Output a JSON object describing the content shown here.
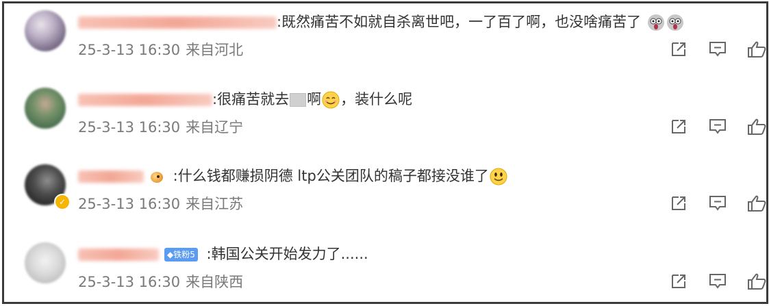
{
  "comments": [
    {
      "text": ":既然痛苦不如就自杀离世吧，一了百了啊，也没啥痛苦了",
      "date": "25-3-13 16:30",
      "location": "来自河北"
    },
    {
      "text_a": ":很痛苦就去",
      "text_b": "啊",
      "text_c": "，装什么呢",
      "date": "25-3-13 16:30",
      "location": "来自辽宁"
    },
    {
      "text": " :什么钱都赚损阴德 ltp公关团队的稿子都接没谁了",
      "date": "25-3-13 16:30",
      "location": "来自江苏"
    },
    {
      "fan_badge": "◆铁粉5",
      "text": " :韩国公关开始发力了......",
      "date": "25-3-13 16:30",
      "location": "来自陕西"
    }
  ],
  "icons": {
    "share": "share-icon",
    "reply": "comment-icon",
    "like": "thumbs-up-icon",
    "verified": "verified-badge-icon"
  },
  "colors": {
    "text": "#333333",
    "meta": "#7a7a7a",
    "icon": "#666666",
    "fan_badge": "#5b9cf0",
    "verified": "#f7b500"
  }
}
